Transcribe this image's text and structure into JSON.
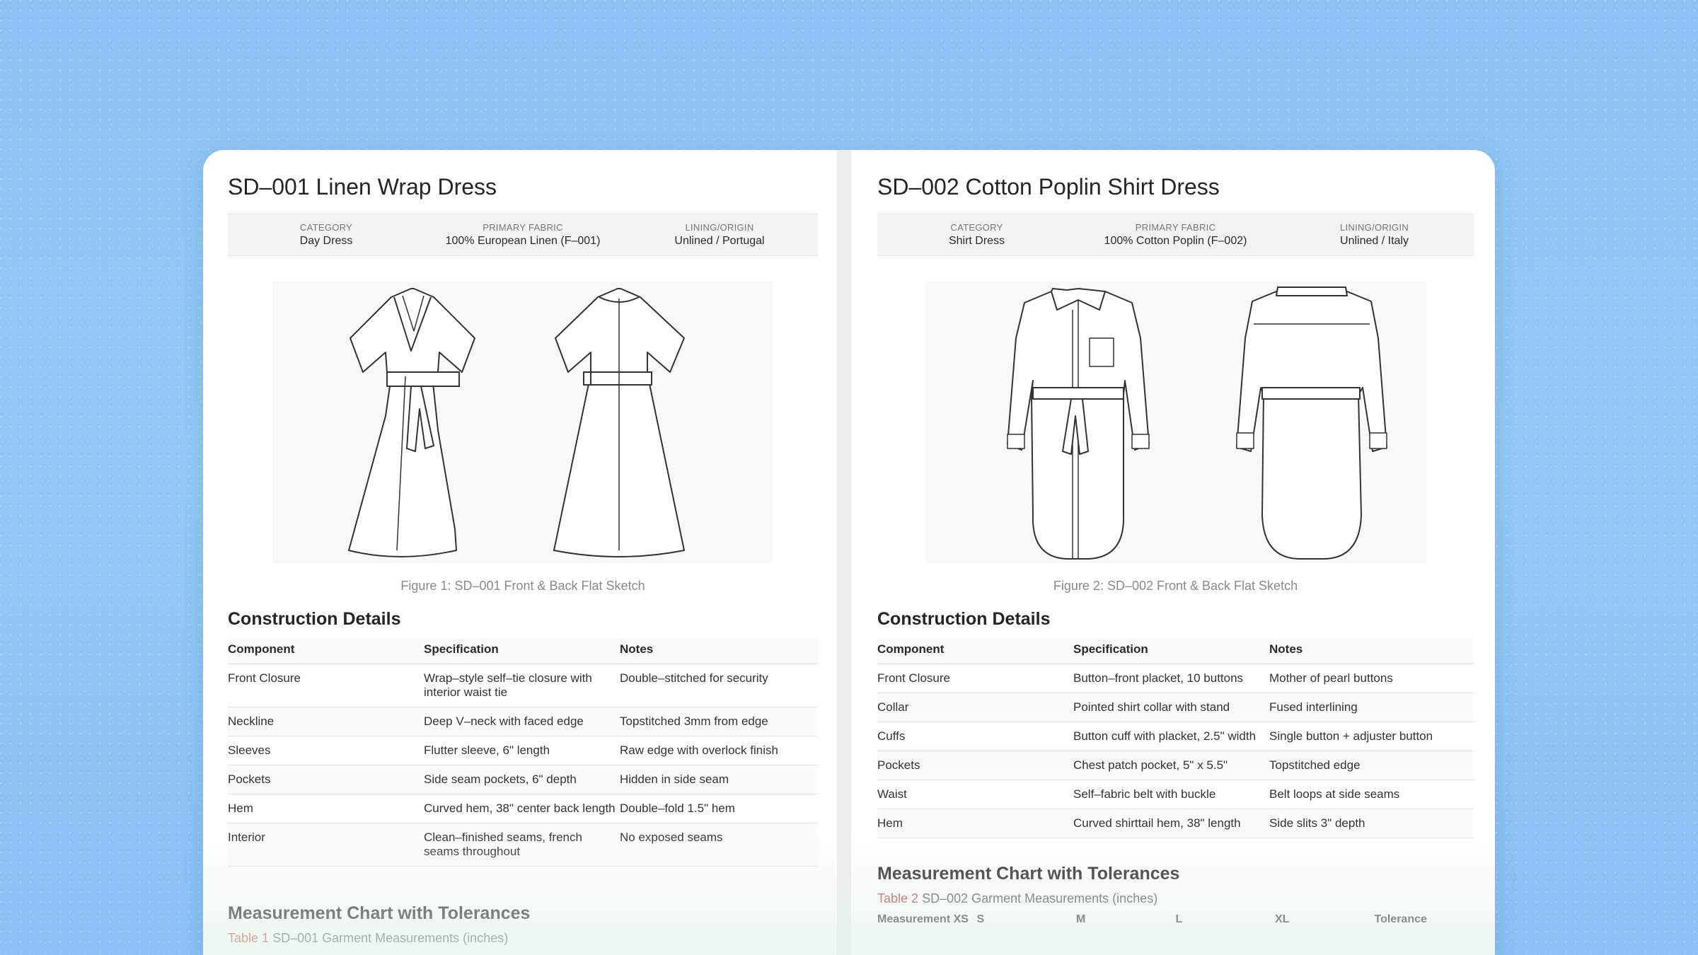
{
  "left": {
    "title": "SD–001 Linen Wrap Dress",
    "meta": [
      {
        "label": "CATEGORY",
        "value": "Day Dress"
      },
      {
        "label": "PRIMARY FABRIC",
        "value": "100% European Linen (F–001)"
      },
      {
        "label": "LINING/ORIGIN",
        "value": "Unlined / Portugal"
      }
    ],
    "caption": "Figure 1: SD–001 Front & Back Flat Sketch",
    "construction_title": "Construction Details",
    "headers": [
      "Component",
      "Specification",
      "Notes"
    ],
    "rows": [
      [
        "Front Closure",
        "Wrap–style self–tie closure with interior waist tie",
        "Double–stitched for security"
      ],
      [
        "Neckline",
        "Deep V–neck with faced edge",
        "Topstitched 3mm from edge"
      ],
      [
        "Sleeves",
        "Flutter sleeve, 6\" length",
        "Raw edge with overlock finish"
      ],
      [
        "Pockets",
        "Side seam pockets, 6\" depth",
        "Hidden in side seam"
      ],
      [
        "Hem",
        "Curved hem, 38\" center back length",
        "Double–fold 1.5\" hem"
      ],
      [
        "Interior",
        "Clean–finished seams, french seams throughout",
        "No exposed seams"
      ]
    ],
    "measure_title": "Measurement Chart with Tolerances",
    "table_num": "Table 1",
    "table_caption": "SD–001 Garment Measurements (inches)"
  },
  "right": {
    "title": "SD–002 Cotton Poplin Shirt Dress",
    "meta": [
      {
        "label": "CATEGORY",
        "value": "Shirt Dress"
      },
      {
        "label": "PRIMARY FABRIC",
        "value": "100% Cotton Poplin (F–002)"
      },
      {
        "label": "LINING/ORIGIN",
        "value": "Unlined / Italy"
      }
    ],
    "caption": "Figure 2: SD–002 Front & Back Flat Sketch",
    "construction_title": "Construction Details",
    "headers": [
      "Component",
      "Specification",
      "Notes"
    ],
    "rows": [
      [
        "Front Closure",
        "Button–front placket, 10 buttons",
        "Mother of pearl buttons"
      ],
      [
        "Collar",
        "Pointed shirt collar with stand",
        "Fused interlining"
      ],
      [
        "Cuffs",
        "Button cuff with placket, 2.5\" width",
        "Single button + adjuster button"
      ],
      [
        "Pockets",
        "Chest patch pocket, 5\" x 5.5\"",
        "Topstitched edge"
      ],
      [
        "Waist",
        "Self–fabric belt with buckle",
        "Belt loops at side seams"
      ],
      [
        "Hem",
        "Curved shirttail hem, 38\" length",
        "Side slits 3\" depth"
      ]
    ],
    "measure_title": "Measurement Chart with Tolerances",
    "table_num": "Table 2",
    "table_caption": "SD–002 Garment Measurements (inches)",
    "measure_headers": [
      "Measurement XS",
      "S",
      "M",
      "L",
      "XL",
      "Tolerance"
    ]
  }
}
